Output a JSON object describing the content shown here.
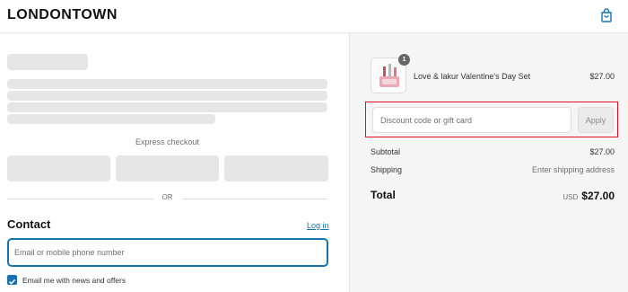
{
  "header": {
    "logo": "LONDONTOWN",
    "cart_icon": "shopping-bag-icon"
  },
  "checkout": {
    "express_label": "Express checkout",
    "or_label": "OR",
    "contact_title": "Contact",
    "login_link": "Log in",
    "email_placeholder": "Email or mobile phone number",
    "newsletter_label": "Email me with news and offers",
    "newsletter_checked": true
  },
  "order": {
    "item": {
      "name": "Love & lakur Valentine's Day Set",
      "price": "$27.00",
      "quantity": "1"
    },
    "discount_placeholder": "Discount code or gift card",
    "apply_label": "Apply",
    "subtotal_label": "Subtotal",
    "subtotal_value": "$27.00",
    "shipping_label": "Shipping",
    "shipping_value": "Enter shipping address",
    "total_label": "Total",
    "currency": "USD",
    "total_value": "$27.00"
  },
  "colors": {
    "accent": "#1773b0",
    "highlight_border": "#e20c1d",
    "summary_bg": "#f5f5f5",
    "skeleton": "#e6e6e6"
  }
}
